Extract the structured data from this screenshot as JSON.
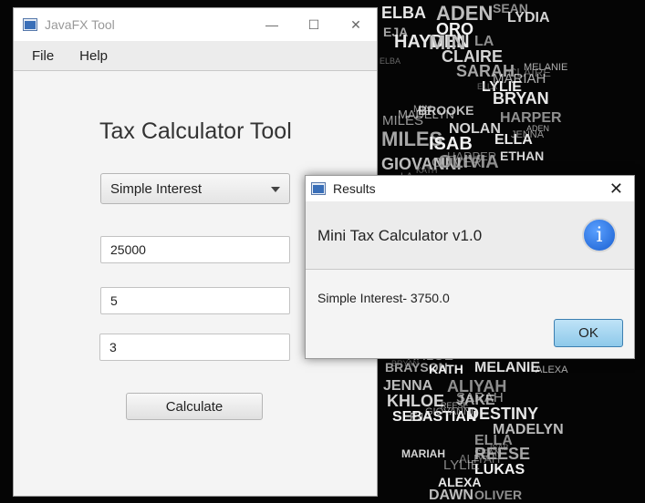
{
  "main_window": {
    "title": "JavaFX Tool",
    "menu": [
      "File",
      "Help"
    ],
    "heading": "Tax Calculator Tool",
    "calc_type": "Simple Interest",
    "inputs": [
      "25000",
      "5",
      "3"
    ],
    "calculate_label": "Calculate"
  },
  "dialog": {
    "title": "Results",
    "header": "Mini Tax Calculator v1.0",
    "info_glyph": "i",
    "message": "Simple Interest- 3750.0",
    "ok_label": "OK"
  },
  "wallpaper_words": [
    "ELBA",
    "ADEN",
    "SEAN",
    "LYDIA",
    "EJA",
    "ORO",
    "HAYDEN",
    "MIN",
    "LA",
    "CLAIRE",
    "SARAH",
    "LYLIE",
    "BRYAN",
    "BROOKE",
    "HARPER",
    "NOLAN",
    "MILES",
    "ISAB",
    "ELLA",
    "GIOVANNI",
    "OLIVIA",
    "ETHAN",
    "BRAYSON",
    "KATH",
    "MELANIE",
    "JENNA",
    "ALIYAH",
    "KHLOE",
    "JAKE",
    "SEBASTIAN",
    "DESTINY",
    "MADELYN",
    "ELLA",
    "MARIAH",
    "REESE",
    "LUKAS",
    "ALEXA",
    "DAWN",
    "OLIVER"
  ],
  "colors": {
    "window_bg": "#f4f4f4",
    "info_blue": "#1a5fd0",
    "ok_button": "#8ec9ea"
  }
}
